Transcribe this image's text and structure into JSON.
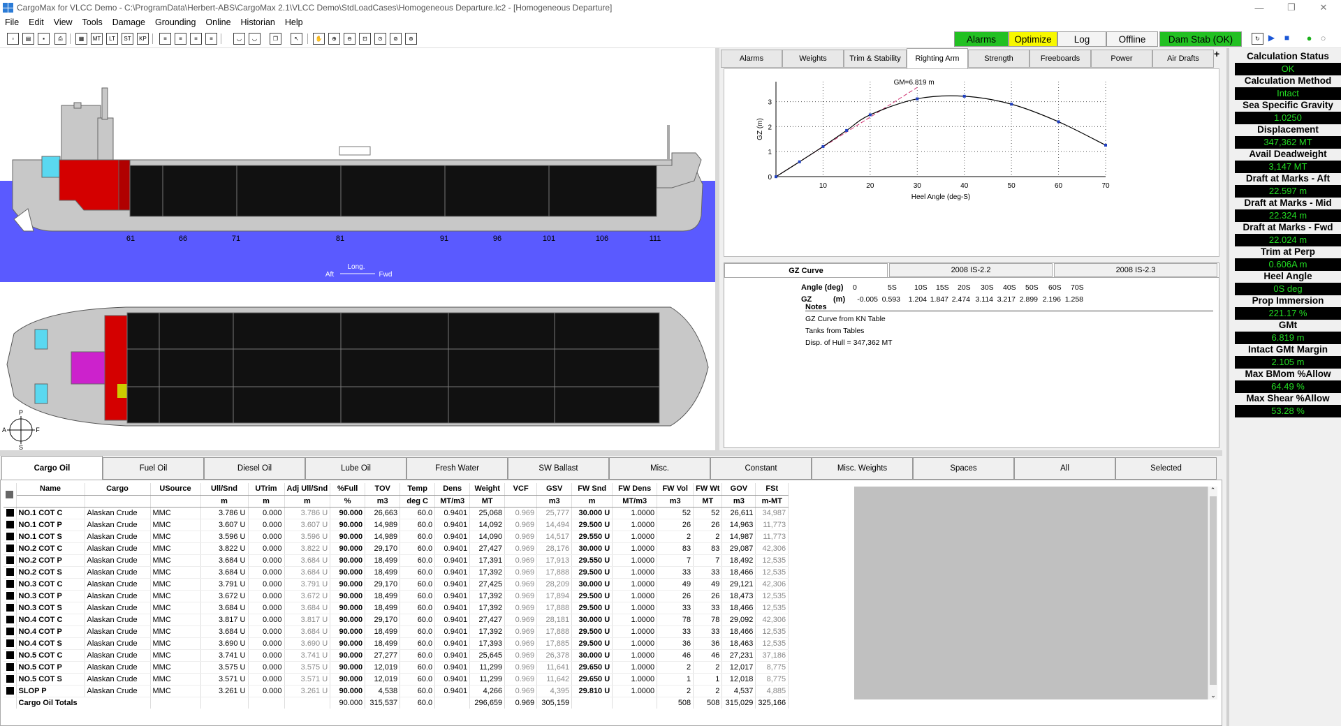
{
  "window": {
    "title": "CargoMax for VLCC Demo - C:\\ProgramData\\Herbert-ABS\\CargoMax 2.1\\VLCC Demo\\StdLoadCases\\Homogeneous Departure.lc2 - [Homogeneous Departure]"
  },
  "menu": [
    "File",
    "Edit",
    "View",
    "Tools",
    "Damage",
    "Grounding",
    "Online",
    "Historian",
    "Help"
  ],
  "status_buttons": {
    "alarms": "Alarms",
    "optimize": "Optimize",
    "log": "Log",
    "offline": "Offline",
    "damstab": "Dam Stab (OK)"
  },
  "profile": {
    "frames": [
      "61",
      "66",
      "71",
      "81",
      "91",
      "96",
      "101",
      "106",
      "111"
    ],
    "long_label": "Long.",
    "aft": "Aft",
    "fwd": "Fwd"
  },
  "compass": {
    "p": "P",
    "s": "S",
    "a": "A",
    "f": "F"
  },
  "tabs_top": [
    "Alarms",
    "Weights",
    "Trim & Stability",
    "Righting Arm",
    "Strength",
    "Freeboards",
    "Power",
    "Air Drafts"
  ],
  "chart_data": {
    "type": "line",
    "xlabel": "Heel Angle (deg-S)",
    "ylabel": "GZ (m)",
    "xlim": [
      0,
      70
    ],
    "ylim": [
      0,
      3.8
    ],
    "xticks": [
      10,
      20,
      30,
      40,
      50,
      60,
      70
    ],
    "yticks": [
      0,
      1,
      2,
      3
    ],
    "gm_label": "GM=6.819 m",
    "series": [
      {
        "x": [
          0,
          5,
          10,
          15,
          20,
          30,
          40,
          50,
          60,
          70
        ],
        "values": [
          -0.005,
          0.593,
          1.204,
          1.847,
          2.474,
          3.114,
          3.217,
          2.899,
          2.196,
          1.258
        ]
      }
    ],
    "gm_line": {
      "x": [
        0,
        30
      ],
      "y": [
        0,
        3.57
      ]
    },
    "grid": true
  },
  "gz_tabs": [
    "GZ Curve",
    "2008 IS-2.2",
    "2008 IS-2.3"
  ],
  "gz_table": {
    "angle_label": "Angle (deg)",
    "gz_label": "GZ",
    "gz_unit": "(m)",
    "angles": [
      "0",
      "5S",
      "10S",
      "15S",
      "20S",
      "30S",
      "40S",
      "50S",
      "60S",
      "70S"
    ],
    "gz": [
      "-0.005",
      "0.593",
      "1.204",
      "1.847",
      "2.474",
      "3.114",
      "3.217",
      "2.899",
      "2.196",
      "1.258"
    ]
  },
  "notes": {
    "title": "Notes",
    "lines": [
      "GZ Curve from KN Table",
      "Tanks from Tables",
      "Disp. of Hull = 347,362 MT"
    ]
  },
  "status_panel": [
    {
      "label": "Calculation Status",
      "value": "OK"
    },
    {
      "label": "Calculation Method",
      "value": "Intact"
    },
    {
      "label": "Sea Specific Gravity",
      "value": "1.0250"
    },
    {
      "label": "Displacement",
      "value": "347,362 MT"
    },
    {
      "label": "Avail Deadweight",
      "value": "3,147 MT"
    },
    {
      "label": "Draft at Marks - Aft",
      "value": "22.597 m"
    },
    {
      "label": "Draft at Marks - Mid",
      "value": "22.324 m"
    },
    {
      "label": "Draft at Marks - Fwd",
      "value": "22.024 m"
    },
    {
      "label": "Trim at Perp",
      "value": "0.606A m"
    },
    {
      "label": "Heel Angle",
      "value": "0S deg"
    },
    {
      "label": "Prop Immersion",
      "value": "221.17 %"
    },
    {
      "label": "GMt",
      "value": "6.819 m"
    },
    {
      "label": "Intact GMt Margin",
      "value": "2.105 m"
    },
    {
      "label": "Max BMom %Allow",
      "value": "64.49 %"
    },
    {
      "label": "Max Shear %Allow",
      "value": "53.28 %"
    }
  ],
  "tabs_bottom": [
    "Cargo Oil",
    "Fuel Oil",
    "Diesel Oil",
    "Lube Oil",
    "Fresh Water",
    "SW Ballast",
    "Misc.",
    "Constant",
    "Misc. Weights",
    "Spaces",
    "All",
    "Selected"
  ],
  "table": {
    "headers": [
      "Name",
      "Cargo",
      "USource",
      "Ull/Snd",
      "UTrim",
      "Adj Ull/Snd",
      "%Full",
      "TOV",
      "Temp",
      "Dens",
      "Weight",
      "VCF",
      "GSV",
      "FW Snd",
      "FW Dens",
      "FW Vol",
      "FW Wt",
      "GOV",
      "FSt"
    ],
    "units": [
      "",
      "",
      "",
      "m",
      "m",
      "m",
      "%",
      "m3",
      "deg C",
      "MT/m3",
      "MT",
      "",
      "m3",
      "m",
      "MT/m3",
      "m3",
      "MT",
      "m3",
      "m-MT"
    ],
    "rows": [
      [
        "NO.1 COT C",
        "Alaskan Crude",
        "MMC",
        "3.786 U",
        "0.000",
        "3.786 U",
        "90.000",
        "26,663",
        "60.0",
        "0.9401",
        "25,068",
        "0.969",
        "25,777",
        "30.000 U",
        "1.0000",
        "52",
        "52",
        "26,611",
        "34,987"
      ],
      [
        "NO.1 COT P",
        "Alaskan Crude",
        "MMC",
        "3.607 U",
        "0.000",
        "3.607 U",
        "90.000",
        "14,989",
        "60.0",
        "0.9401",
        "14,092",
        "0.969",
        "14,494",
        "29.500 U",
        "1.0000",
        "26",
        "26",
        "14,963",
        "11,773"
      ],
      [
        "NO.1 COT S",
        "Alaskan Crude",
        "MMC",
        "3.596 U",
        "0.000",
        "3.596 U",
        "90.000",
        "14,989",
        "60.0",
        "0.9401",
        "14,090",
        "0.969",
        "14,517",
        "29.550 U",
        "1.0000",
        "2",
        "2",
        "14,987",
        "11,773"
      ],
      [
        "NO.2 COT C",
        "Alaskan Crude",
        "MMC",
        "3.822 U",
        "0.000",
        "3.822 U",
        "90.000",
        "29,170",
        "60.0",
        "0.9401",
        "27,427",
        "0.969",
        "28,176",
        "30.000 U",
        "1.0000",
        "83",
        "83",
        "29,087",
        "42,306"
      ],
      [
        "NO.2 COT P",
        "Alaskan Crude",
        "MMC",
        "3.684 U",
        "0.000",
        "3.684 U",
        "90.000",
        "18,499",
        "60.0",
        "0.9401",
        "17,391",
        "0.969",
        "17,913",
        "29.550 U",
        "1.0000",
        "7",
        "7",
        "18,492",
        "12,535"
      ],
      [
        "NO.2 COT S",
        "Alaskan Crude",
        "MMC",
        "3.684 U",
        "0.000",
        "3.684 U",
        "90.000",
        "18,499",
        "60.0",
        "0.9401",
        "17,392",
        "0.969",
        "17,888",
        "29.500 U",
        "1.0000",
        "33",
        "33",
        "18,466",
        "12,535"
      ],
      [
        "NO.3 COT C",
        "Alaskan Crude",
        "MMC",
        "3.791 U",
        "0.000",
        "3.791 U",
        "90.000",
        "29,170",
        "60.0",
        "0.9401",
        "27,425",
        "0.969",
        "28,209",
        "30.000 U",
        "1.0000",
        "49",
        "49",
        "29,121",
        "42,306"
      ],
      [
        "NO.3 COT P",
        "Alaskan Crude",
        "MMC",
        "3.672 U",
        "0.000",
        "3.672 U",
        "90.000",
        "18,499",
        "60.0",
        "0.9401",
        "17,392",
        "0.969",
        "17,894",
        "29.500 U",
        "1.0000",
        "26",
        "26",
        "18,473",
        "12,535"
      ],
      [
        "NO.3 COT S",
        "Alaskan Crude",
        "MMC",
        "3.684 U",
        "0.000",
        "3.684 U",
        "90.000",
        "18,499",
        "60.0",
        "0.9401",
        "17,392",
        "0.969",
        "17,888",
        "29.500 U",
        "1.0000",
        "33",
        "33",
        "18,466",
        "12,535"
      ],
      [
        "NO.4 COT C",
        "Alaskan Crude",
        "MMC",
        "3.817 U",
        "0.000",
        "3.817 U",
        "90.000",
        "29,170",
        "60.0",
        "0.9401",
        "27,427",
        "0.969",
        "28,181",
        "30.000 U",
        "1.0000",
        "78",
        "78",
        "29,092",
        "42,306"
      ],
      [
        "NO.4 COT P",
        "Alaskan Crude",
        "MMC",
        "3.684 U",
        "0.000",
        "3.684 U",
        "90.000",
        "18,499",
        "60.0",
        "0.9401",
        "17,392",
        "0.969",
        "17,888",
        "29.500 U",
        "1.0000",
        "33",
        "33",
        "18,466",
        "12,535"
      ],
      [
        "NO.4 COT S",
        "Alaskan Crude",
        "MMC",
        "3.690 U",
        "0.000",
        "3.690 U",
        "90.000",
        "18,499",
        "60.0",
        "0.9401",
        "17,393",
        "0.969",
        "17,885",
        "29.500 U",
        "1.0000",
        "36",
        "36",
        "18,463",
        "12,535"
      ],
      [
        "NO.5 COT C",
        "Alaskan Crude",
        "MMC",
        "3.741 U",
        "0.000",
        "3.741 U",
        "90.000",
        "27,277",
        "60.0",
        "0.9401",
        "25,645",
        "0.969",
        "26,378",
        "30.000 U",
        "1.0000",
        "46",
        "46",
        "27,231",
        "37,186"
      ],
      [
        "NO.5 COT P",
        "Alaskan Crude",
        "MMC",
        "3.575 U",
        "0.000",
        "3.575 U",
        "90.000",
        "12,019",
        "60.0",
        "0.9401",
        "11,299",
        "0.969",
        "11,641",
        "29.650 U",
        "1.0000",
        "2",
        "2",
        "12,017",
        "8,775"
      ],
      [
        "NO.5 COT S",
        "Alaskan Crude",
        "MMC",
        "3.571 U",
        "0.000",
        "3.571 U",
        "90.000",
        "12,019",
        "60.0",
        "0.9401",
        "11,299",
        "0.969",
        "11,642",
        "29.650 U",
        "1.0000",
        "1",
        "1",
        "12,018",
        "8,775"
      ],
      [
        "SLOP P",
        "Alaskan Crude",
        "MMC",
        "3.261 U",
        "0.000",
        "3.261 U",
        "90.000",
        "4,538",
        "60.0",
        "0.9401",
        "4,266",
        "0.969",
        "4,395",
        "29.810 U",
        "1.0000",
        "2",
        "2",
        "4,537",
        "4,885"
      ]
    ],
    "totals": {
      "label": "Cargo Oil Totals",
      "full": "90.000",
      "tov": "315,537",
      "temp": "60.0",
      "weight": "296,659",
      "vcf": "0.969",
      "gsv": "305,159",
      "fwvol": "508",
      "fwwt": "508",
      "gov": "315,029",
      "fst": "325,166"
    }
  }
}
